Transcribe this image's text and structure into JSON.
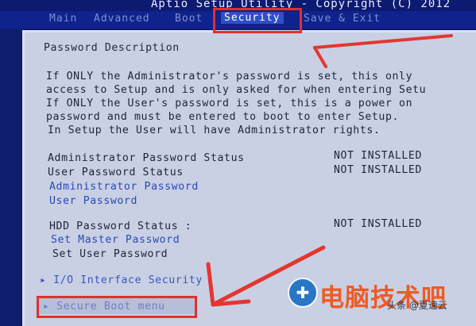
{
  "title_bar": {
    "text": "Aptio Setup Utility - Copyright (C) 2012"
  },
  "menu_bar": {
    "tabs": [
      {
        "label": "Main"
      },
      {
        "label": "Advanced"
      },
      {
        "label": "Boot"
      },
      {
        "label": "Security",
        "active": true
      },
      {
        "label": "Save & Exit"
      }
    ]
  },
  "panel": {
    "heading": "Password Description",
    "description": [
      "If ONLY the Administrator's password is set, this only",
      "access to Setup and is only asked for when entering Setu",
      "If ONLY the User's password is set, this is a power on",
      "password and must be entered to boot to enter Setup.",
      "In Setup the User will have Administrator rights."
    ],
    "admin_status_label": "Administrator Password Status",
    "admin_status_value": "NOT INSTALLED",
    "user_status_label": "User Password Status",
    "user_status_value": "NOT INSTALLED",
    "admin_password_link": "Administrator Password",
    "user_password_link": "User Password",
    "hdd_status_label": "HDD Password Status  :",
    "hdd_status_value": "NOT INSTALLED",
    "set_master_password": "Set Master Password",
    "set_user_password": "Set User Password",
    "io_interface_security": "I/O Interface Security",
    "secure_boot_menu": "Secure Boot menu"
  },
  "watermark": {
    "brand_text": "电脑技术吧",
    "author_text": "头条 @夏速云"
  },
  "colors": {
    "background": "#0f1d6e",
    "panel": "#c9d0e4",
    "link": "#2b49b8",
    "annotation_red": "#e0312b",
    "brand_orange": "#f05a23"
  }
}
